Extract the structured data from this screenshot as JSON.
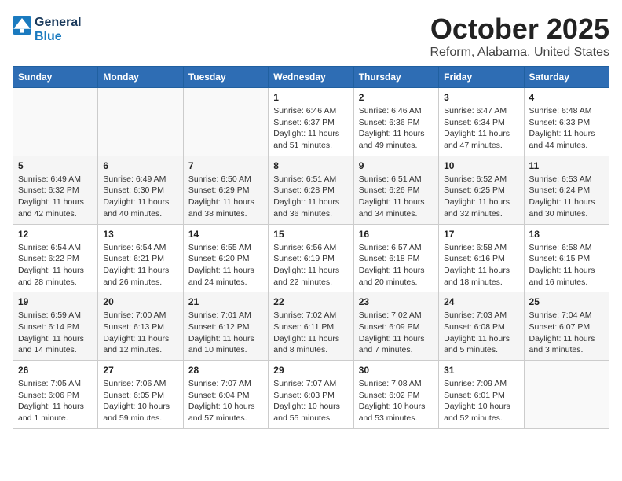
{
  "header": {
    "logo_line1": "General",
    "logo_line2": "Blue",
    "title": "October 2025",
    "subtitle": "Reform, Alabama, United States"
  },
  "weekdays": [
    "Sunday",
    "Monday",
    "Tuesday",
    "Wednesday",
    "Thursday",
    "Friday",
    "Saturday"
  ],
  "weeks": [
    [
      {
        "day": "",
        "info": ""
      },
      {
        "day": "",
        "info": ""
      },
      {
        "day": "",
        "info": ""
      },
      {
        "day": "1",
        "info": "Sunrise: 6:46 AM\nSunset: 6:37 PM\nDaylight: 11 hours\nand 51 minutes."
      },
      {
        "day": "2",
        "info": "Sunrise: 6:46 AM\nSunset: 6:36 PM\nDaylight: 11 hours\nand 49 minutes."
      },
      {
        "day": "3",
        "info": "Sunrise: 6:47 AM\nSunset: 6:34 PM\nDaylight: 11 hours\nand 47 minutes."
      },
      {
        "day": "4",
        "info": "Sunrise: 6:48 AM\nSunset: 6:33 PM\nDaylight: 11 hours\nand 44 minutes."
      }
    ],
    [
      {
        "day": "5",
        "info": "Sunrise: 6:49 AM\nSunset: 6:32 PM\nDaylight: 11 hours\nand 42 minutes."
      },
      {
        "day": "6",
        "info": "Sunrise: 6:49 AM\nSunset: 6:30 PM\nDaylight: 11 hours\nand 40 minutes."
      },
      {
        "day": "7",
        "info": "Sunrise: 6:50 AM\nSunset: 6:29 PM\nDaylight: 11 hours\nand 38 minutes."
      },
      {
        "day": "8",
        "info": "Sunrise: 6:51 AM\nSunset: 6:28 PM\nDaylight: 11 hours\nand 36 minutes."
      },
      {
        "day": "9",
        "info": "Sunrise: 6:51 AM\nSunset: 6:26 PM\nDaylight: 11 hours\nand 34 minutes."
      },
      {
        "day": "10",
        "info": "Sunrise: 6:52 AM\nSunset: 6:25 PM\nDaylight: 11 hours\nand 32 minutes."
      },
      {
        "day": "11",
        "info": "Sunrise: 6:53 AM\nSunset: 6:24 PM\nDaylight: 11 hours\nand 30 minutes."
      }
    ],
    [
      {
        "day": "12",
        "info": "Sunrise: 6:54 AM\nSunset: 6:22 PM\nDaylight: 11 hours\nand 28 minutes."
      },
      {
        "day": "13",
        "info": "Sunrise: 6:54 AM\nSunset: 6:21 PM\nDaylight: 11 hours\nand 26 minutes."
      },
      {
        "day": "14",
        "info": "Sunrise: 6:55 AM\nSunset: 6:20 PM\nDaylight: 11 hours\nand 24 minutes."
      },
      {
        "day": "15",
        "info": "Sunrise: 6:56 AM\nSunset: 6:19 PM\nDaylight: 11 hours\nand 22 minutes."
      },
      {
        "day": "16",
        "info": "Sunrise: 6:57 AM\nSunset: 6:18 PM\nDaylight: 11 hours\nand 20 minutes."
      },
      {
        "day": "17",
        "info": "Sunrise: 6:58 AM\nSunset: 6:16 PM\nDaylight: 11 hours\nand 18 minutes."
      },
      {
        "day": "18",
        "info": "Sunrise: 6:58 AM\nSunset: 6:15 PM\nDaylight: 11 hours\nand 16 minutes."
      }
    ],
    [
      {
        "day": "19",
        "info": "Sunrise: 6:59 AM\nSunset: 6:14 PM\nDaylight: 11 hours\nand 14 minutes."
      },
      {
        "day": "20",
        "info": "Sunrise: 7:00 AM\nSunset: 6:13 PM\nDaylight: 11 hours\nand 12 minutes."
      },
      {
        "day": "21",
        "info": "Sunrise: 7:01 AM\nSunset: 6:12 PM\nDaylight: 11 hours\nand 10 minutes."
      },
      {
        "day": "22",
        "info": "Sunrise: 7:02 AM\nSunset: 6:11 PM\nDaylight: 11 hours\nand 8 minutes."
      },
      {
        "day": "23",
        "info": "Sunrise: 7:02 AM\nSunset: 6:09 PM\nDaylight: 11 hours\nand 7 minutes."
      },
      {
        "day": "24",
        "info": "Sunrise: 7:03 AM\nSunset: 6:08 PM\nDaylight: 11 hours\nand 5 minutes."
      },
      {
        "day": "25",
        "info": "Sunrise: 7:04 AM\nSunset: 6:07 PM\nDaylight: 11 hours\nand 3 minutes."
      }
    ],
    [
      {
        "day": "26",
        "info": "Sunrise: 7:05 AM\nSunset: 6:06 PM\nDaylight: 11 hours\nand 1 minute."
      },
      {
        "day": "27",
        "info": "Sunrise: 7:06 AM\nSunset: 6:05 PM\nDaylight: 10 hours\nand 59 minutes."
      },
      {
        "day": "28",
        "info": "Sunrise: 7:07 AM\nSunset: 6:04 PM\nDaylight: 10 hours\nand 57 minutes."
      },
      {
        "day": "29",
        "info": "Sunrise: 7:07 AM\nSunset: 6:03 PM\nDaylight: 10 hours\nand 55 minutes."
      },
      {
        "day": "30",
        "info": "Sunrise: 7:08 AM\nSunset: 6:02 PM\nDaylight: 10 hours\nand 53 minutes."
      },
      {
        "day": "31",
        "info": "Sunrise: 7:09 AM\nSunset: 6:01 PM\nDaylight: 10 hours\nand 52 minutes."
      },
      {
        "day": "",
        "info": ""
      }
    ]
  ]
}
